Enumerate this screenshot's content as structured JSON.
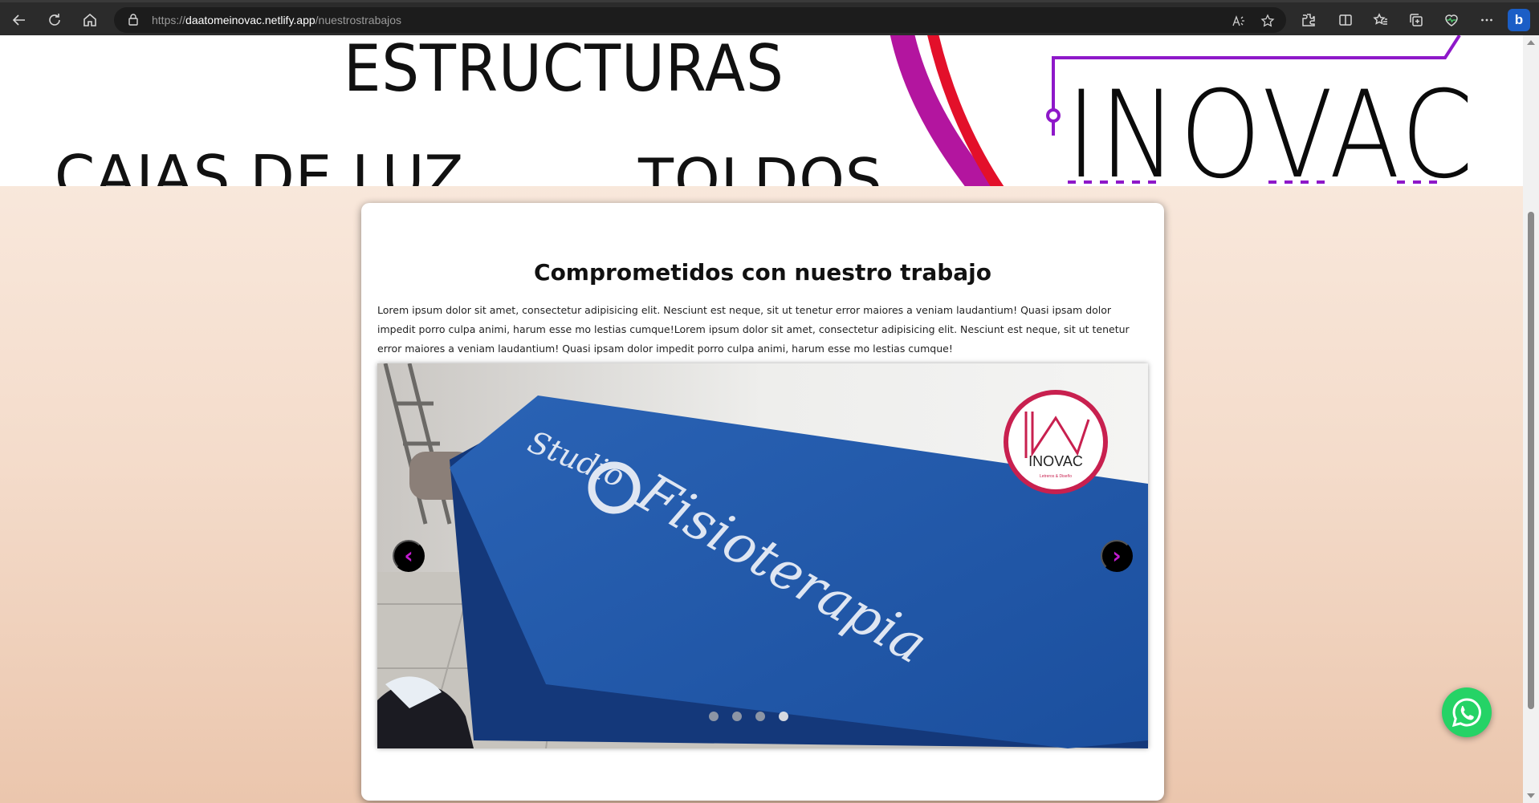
{
  "browser": {
    "url_scheme": "https://",
    "url_host": "daatomeinovac.netlify.app",
    "url_path": "/nuestrostrabajos",
    "icons": [
      "back-icon",
      "refresh-icon",
      "home-icon",
      "lock-icon",
      "read-aloud-icon",
      "favorite-star-icon",
      "extensions-icon",
      "split-screen-icon",
      "favorites-icon",
      "collections-icon",
      "browser-essentials-icon",
      "more-icon",
      "bing-icon"
    ],
    "bing_label": "b"
  },
  "hero": {
    "words": {
      "estructuras": "ESTRUCTURAS",
      "cajas": "CAJAS DE LUZ",
      "toldos": "TOLDOS",
      "brand": "INOVAC"
    },
    "colors": {
      "purple": "#8e18c9",
      "magenta": "#b3159f",
      "red": "#e3102a"
    }
  },
  "card": {
    "title": "Comprometidos con nuestro trabajo",
    "body": "Lorem ipsum dolor sit amet, consectetur adipisicing elit. Nesciunt est neque, sit ut tenetur error maiores a veniam laudantium! Quasi ipsam dolor impedit porro culpa animi, harum esse mo lestias cumque!Lorem ipsum dolor sit amet, consectetur adipisicing elit. Nesciunt est neque, sit ut tenetur error maiores a veniam laudantium! Quasi ipsam dolor impedit porro culpa animi, harum esse mo lestias cumque!"
  },
  "carousel": {
    "slide_sign_brand": "Studio",
    "slide_sign_text": "Fisioterapia",
    "logo_text": "INOVAC",
    "logo_subtext": "Letreros & Diseño",
    "prev_label": "‹",
    "next_label": "›",
    "slide_count": 4,
    "active_index": 3,
    "colors": {
      "sign_blue": "#1d5fb5",
      "control_accent": "#c21bd0",
      "logo_ring": "#c8204f"
    }
  },
  "whatsapp": {
    "icon": "whatsapp-icon",
    "color": "#25d366"
  }
}
